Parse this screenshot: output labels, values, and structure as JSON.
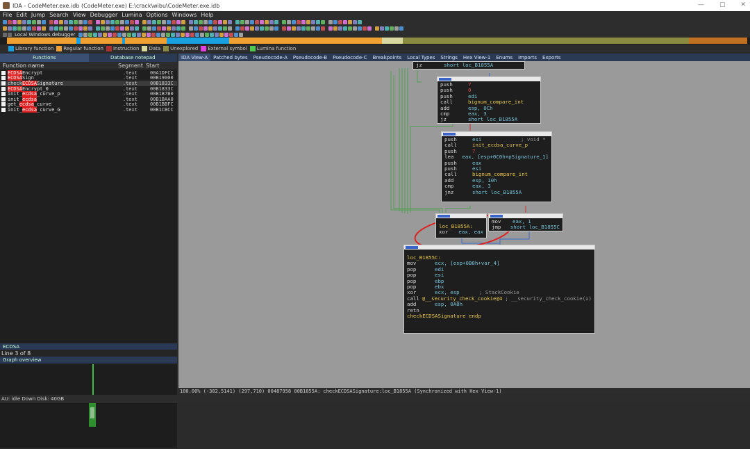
{
  "window": {
    "title": "IDA - CodeMeter.exe.idb (CodeMeter.exe) E:\\crack\\wibu\\CodeMeter.exe.idb",
    "controls": [
      "—",
      "▢",
      "✕"
    ]
  },
  "menu": [
    "File",
    "Edit",
    "Jump",
    "Search",
    "View",
    "Debugger",
    "Lumina",
    "Options",
    "Windows",
    "Help"
  ],
  "toolbar": {
    "debugger_label": "Local Windows debugger"
  },
  "legend": [
    {
      "label": "Library function",
      "color": "#19a0e0"
    },
    {
      "label": "Regular function",
      "color": "#f0a030"
    },
    {
      "label": "Instruction",
      "color": "#b03030"
    },
    {
      "label": "Data",
      "color": "#d8d8a0"
    },
    {
      "label": "Unexplored",
      "color": "#8a8a40"
    },
    {
      "label": "External symbol",
      "color": "#e040e0"
    },
    {
      "label": "Lumina function",
      "color": "#50c850"
    }
  ],
  "left_tabs": [
    "Functions",
    "Database notepad"
  ],
  "functions": {
    "columns": [
      "Function name",
      "Segment",
      "Start"
    ],
    "rows": [
      {
        "name": "ECDSAEncrypt",
        "segment": ".text",
        "start": "00A1DFCC",
        "selected": false
      },
      {
        "name": "ECDSASign",
        "segment": ".text",
        "start": "00B19000",
        "selected": false
      },
      {
        "name": "checkECDSASignature",
        "segment": ".text",
        "start": "00B1833C",
        "selected": true
      },
      {
        "name": "ECDSAEncrypt_0",
        "segment": ".text",
        "start": "00B1833C",
        "selected": false
      },
      {
        "name": "init_ecdsa_curve_p",
        "segment": ".text",
        "start": "00B1B7B0",
        "selected": false
      },
      {
        "name": "init_ecdsa",
        "segment": ".text",
        "start": "00B1BAA0",
        "selected": false
      },
      {
        "name": "get_ecdsa_curve",
        "segment": ".text",
        "start": "00B1BBFC",
        "selected": false
      },
      {
        "name": "init_ecdsa_curve_G",
        "segment": ".text",
        "start": "00B1CBCC",
        "selected": false
      }
    ]
  },
  "filter_text": "ECDSA",
  "line_info": "Line 3 of 8",
  "overview_label": "Graph overview",
  "status_bar": "AU:  idle   Down  Disk: 40GB",
  "right_tabs": [
    "IDA View-A",
    "Patched bytes",
    "Pseudocode-A",
    "Pseudocode-B",
    "Pseudocode-C",
    "Breakpoints",
    "Local Types",
    "Strings",
    "Hex View-1",
    "Enums",
    "Imports",
    "Exports"
  ],
  "graph_status": "100.00% (-382,5141) (297,710) 00487958 00B1855A: checkECDSASignature:loc_B1855A (Synchronized with Hex View-1)",
  "blocks": {
    "b0": [
      {
        "m": "jz",
        "o": "short loc_B1855A"
      }
    ],
    "b1": [
      {
        "m": "push",
        "o": "7"
      },
      {
        "m": "push",
        "o": "0"
      },
      {
        "m": "push",
        "o": "edi"
      },
      {
        "m": "call",
        "o": "bignum_compare_int"
      },
      {
        "m": "add",
        "o": "esp, 0Ch"
      },
      {
        "m": "cmp",
        "o": "eax, 3"
      },
      {
        "m": "jz",
        "o": "short loc_B1855A"
      }
    ],
    "b2": [
      {
        "m": "push",
        "o": "esi",
        "c": "; void *"
      },
      {
        "m": "call",
        "o": "init_ecdsa_curve_p"
      },
      {
        "m": "push",
        "o": "7"
      },
      {
        "m": "lea",
        "o": "eax, [esp+0C0h+pSignature_1]"
      },
      {
        "m": "push",
        "o": "eax"
      },
      {
        "m": "push",
        "o": "esi"
      },
      {
        "m": "call",
        "o": "bignum_compare_int"
      },
      {
        "m": "add",
        "o": "esp, 10h"
      },
      {
        "m": "cmp",
        "o": "eax, 3"
      },
      {
        "m": "jnz",
        "o": "short loc_B1855A"
      }
    ],
    "b3": {
      "label": "loc_B1855A:",
      "lines": [
        {
          "m": "xor",
          "o": "eax, eax"
        }
      ]
    },
    "b4": [
      {
        "m": "mov",
        "o": "eax, 1"
      },
      {
        "m": "jmp",
        "o": "short loc_B1855C"
      }
    ],
    "b5": {
      "label": "loc_B1855C:",
      "lines": [
        {
          "m": "mov",
          "o": "ecx, [esp+0B8h+var_4]"
        },
        {
          "m": "pop",
          "o": "edi"
        },
        {
          "m": "pop",
          "o": "esi"
        },
        {
          "m": "pop",
          "o": "ebp"
        },
        {
          "m": "pop",
          "o": "ebx"
        },
        {
          "m": "xor",
          "o": "ecx, esp",
          "c": "; StackCookie"
        },
        {
          "m": "call",
          "o": "@__security_check_cookie@4",
          "c": "; __security_check_cookie(x)"
        },
        {
          "m": "add",
          "o": "esp, 0A8h"
        },
        {
          "m": "retn",
          "o": ""
        }
      ],
      "end": "checkECDSASignature endp"
    }
  }
}
